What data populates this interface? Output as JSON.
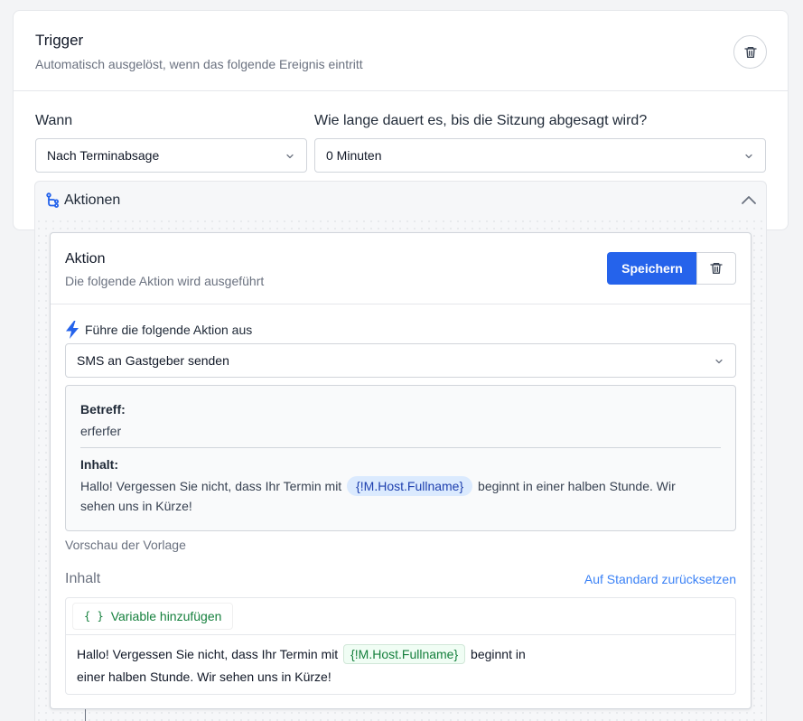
{
  "trigger": {
    "title": "Trigger",
    "subtitle": "Automatisch ausgelöst, wenn das folgende Ereignis eintritt",
    "when_label": "Wann",
    "when_value": "Nach Terminabsage",
    "duration_label": "Wie lange dauert es, bis die Sitzung abgesagt wird?",
    "duration_value": "0 Minuten"
  },
  "actions": {
    "title": "Aktionen"
  },
  "action": {
    "title": "Aktion",
    "subtitle": "Die folgende Aktion wird ausgeführt",
    "save_label": "Speichern",
    "exec_label": "Führe die folgende Aktion aus",
    "action_value": "SMS an Gastgeber senden",
    "preview": {
      "subject_label": "Betreff:",
      "subject_value": "erferfer",
      "content_label": "Inhalt:",
      "body_before": "Hallo! Vergessen Sie nicht, dass Ihr Termin mit",
      "variable": "{!M.Host.Fullname}",
      "body_after": "beginnt in einer halben Stunde. Wir sehen uns in Kürze!"
    },
    "preview_caption": "Vorschau der Vorlage",
    "content_label": "Inhalt",
    "reset_link": "Auf Standard zurücksetzen",
    "add_variable_icon": "{ }",
    "add_variable_label": "Variable hinzufügen",
    "editor": {
      "line1_before": "Hallo! Vergessen Sie nicht, dass Ihr Termin mit",
      "variable": "{!M.Host.Fullname}",
      "line1_after": "beginnt in",
      "line2": "einer halben Stunde. Wir sehen uns in Kürze!"
    }
  },
  "colors": {
    "primary": "#2563eb",
    "link": "#3b82f6",
    "variable_blue_bg": "#dbeafe",
    "variable_green": "#15803d"
  }
}
